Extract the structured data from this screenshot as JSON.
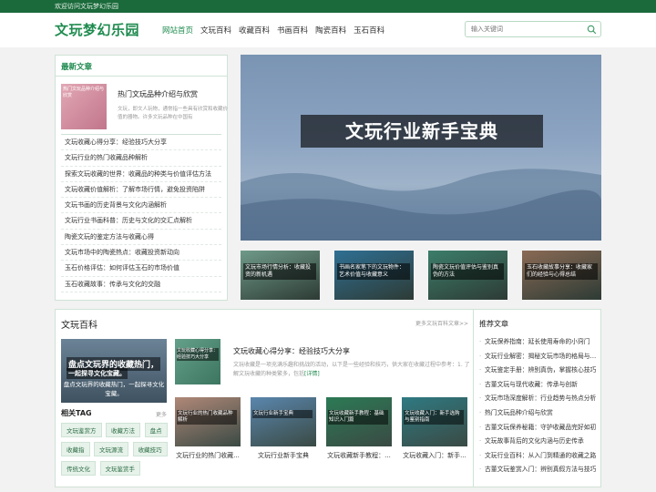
{
  "topbar": {
    "welcome": "欢迎访问文玩梦幻乐园"
  },
  "header": {
    "logo": "文玩梦幻乐园",
    "nav": [
      "网站首页",
      "文玩百科",
      "收藏百科",
      "书画百科",
      "陶瓷百科",
      "玉石百科"
    ],
    "search_placeholder": "输入关键词"
  },
  "latest": {
    "title": "最新文章",
    "feature_thumb": "热门文玩品种介绍与欣赏",
    "feature_title": "热门文玩品种介绍与欣赏",
    "feature_desc": "文玩，即文人玩物，通常指一些具有欣赏和收藏价值的器物。许多文玩品种在中国有",
    "items": [
      "文玩收藏心得分享：经验技巧大分享",
      "文玩行业的热门收藏品种解析",
      "探索文玩收藏的世界：收藏品的种类与价值评估方法",
      "文玩收藏价值解析：了解市场行情，避免投资陷阱",
      "文玩书画的历史背景与文化内涵解析",
      "文玩行业书画科普：历史与文化的交汇点解析",
      "陶瓷文玩的鉴定方法与收藏心得",
      "文玩市场中的陶瓷热点：收藏投资新动向",
      "玉石价格评估：如何评估玉石的市场价值",
      "玉石收藏故事：传承与文化的交融"
    ]
  },
  "hero": {
    "caption": "文玩行业新手宝典"
  },
  "thumbs": [
    {
      "label": "文玩市场行情分析：收藏投资的新机遇",
      "color": "#6f9a89"
    },
    {
      "label": "书画名家笔下的文玩物件：艺术价值与收藏意义",
      "color": "#2f6f93"
    },
    {
      "label": "陶瓷文玩价值评估与鉴别真伪的方法",
      "color": "#3c7d6a"
    },
    {
      "label": "玉石收藏故事分享：收藏家们的经验与心得总结",
      "color": "#8a6a55"
    }
  ],
  "baike": {
    "title": "文玩百科",
    "more": "更多文玩百科文章>>",
    "bigpic_l1": "盘点文玩界的收藏热门，",
    "bigpic_l2": "一起探寻文化宝藏。",
    "bigpic_l3": "盘点文玩界的收藏热门，一起探寻文化宝藏。",
    "tag_title": "相关TAG",
    "tag_more": "更多",
    "tags": [
      "文玩鉴赏方",
      "收藏方法",
      "盘点",
      "收藏指",
      "文玩源流",
      "收藏技巧",
      "传统文化",
      "文玩鉴赏手"
    ],
    "mid_pic": "文玩收藏心得分享：经验技巧大分享",
    "mid_title": "文玩收藏心得分享：经验技巧大分享",
    "mid_desc": "文玩收藏是一项充满乐趣和挑战的活动，以下是一些经验和技巧，供大家在收藏过程中参考：1. 了解文玩收藏的种类繁多，包括",
    "mid_link": "[详情]",
    "cards": [
      {
        "img": "文玩行业的热门收藏品种解析",
        "cap": "文玩行业的热门收藏...",
        "color": "#b08878"
      },
      {
        "img": "文玩行业新手宝典",
        "cap": "文玩行业新手宝典",
        "color": "#5a86ad"
      },
      {
        "img": "文玩收藏新手教程：基础知识入门篇",
        "cap": "文玩收藏新手教程：...",
        "color": "#2c7a55"
      },
      {
        "img": "文玩收藏入门：新手选购与鉴别指南",
        "cap": "文玩收藏入门：新手...",
        "color": "#2f7a82"
      }
    ]
  },
  "recommend": {
    "title": "推荐文章",
    "items": [
      "文玩保养指南：延长使用寿命的小窍门",
      "文玩行业解密：揭秘文玩市场的格局与趋势",
      "文玩鉴定手册：辨别真伪，掌握核心技巧",
      "古董文玩与现代收藏：传承与创新",
      "文玩市场深度解析：行业趋势与热点分析",
      "热门文玩品种介绍与欣赏",
      "古董文玩保养秘籍：守护收藏品完好如初",
      "文玩故事背后的文化内涵与历史传承",
      "文玩行业百科：从入门到精通的收藏之路",
      "古董文玩鉴赏入门：辨别真假方法与技巧"
    ]
  }
}
